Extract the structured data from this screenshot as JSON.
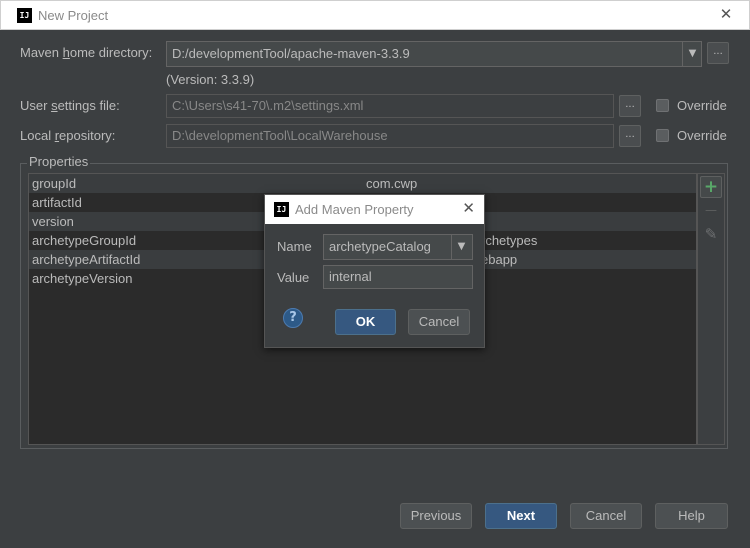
{
  "window": {
    "title": "New Project",
    "logo_text": "IJ"
  },
  "maven": {
    "home_label_pre": "Maven ",
    "home_label_u": "h",
    "home_label_post": "ome directory:",
    "home_value": "D:/developmentTool/apache-maven-3.3.9",
    "version_text": "(Version: 3.3.9)",
    "settings_label_pre": "User ",
    "settings_label_u": "s",
    "settings_label_post": "ettings file:",
    "settings_value": "C:\\Users\\s41-70\\.m2\\settings.xml",
    "repo_label_pre": "Local ",
    "repo_label_u": "r",
    "repo_label_post": "epository:",
    "repo_value": "D:\\developmentTool\\LocalWarehouse",
    "override_label": "Override",
    "browse_label": "..."
  },
  "properties": {
    "legend": "Properties",
    "rows": [
      {
        "key": "groupId",
        "value": "com.cwp"
      },
      {
        "key": "artifactId",
        "value": ""
      },
      {
        "key": "version",
        "value": ""
      },
      {
        "key": "archetypeGroupId",
        "value": "rchetypes"
      },
      {
        "key": "archetypeArtifactId",
        "value": "ebapp"
      },
      {
        "key": "archetypeVersion",
        "value": ""
      }
    ],
    "tools": {
      "add_icon": "+",
      "remove_icon": "—",
      "edit_icon": "✎"
    }
  },
  "footer": {
    "previous": "Previous",
    "next": "Next",
    "cancel": "Cancel",
    "help": "Help"
  },
  "dialog": {
    "title": "Add Maven Property",
    "logo_text": "IJ",
    "name_label": "Name",
    "name_value": "archetypeCatalog",
    "value_label": "Value",
    "value_value": "internal",
    "help_icon": "?",
    "ok": "OK",
    "cancel": "Cancel"
  },
  "colors": {
    "accent": "#365880",
    "background": "#3c3f41",
    "add_green": "#59a869"
  }
}
